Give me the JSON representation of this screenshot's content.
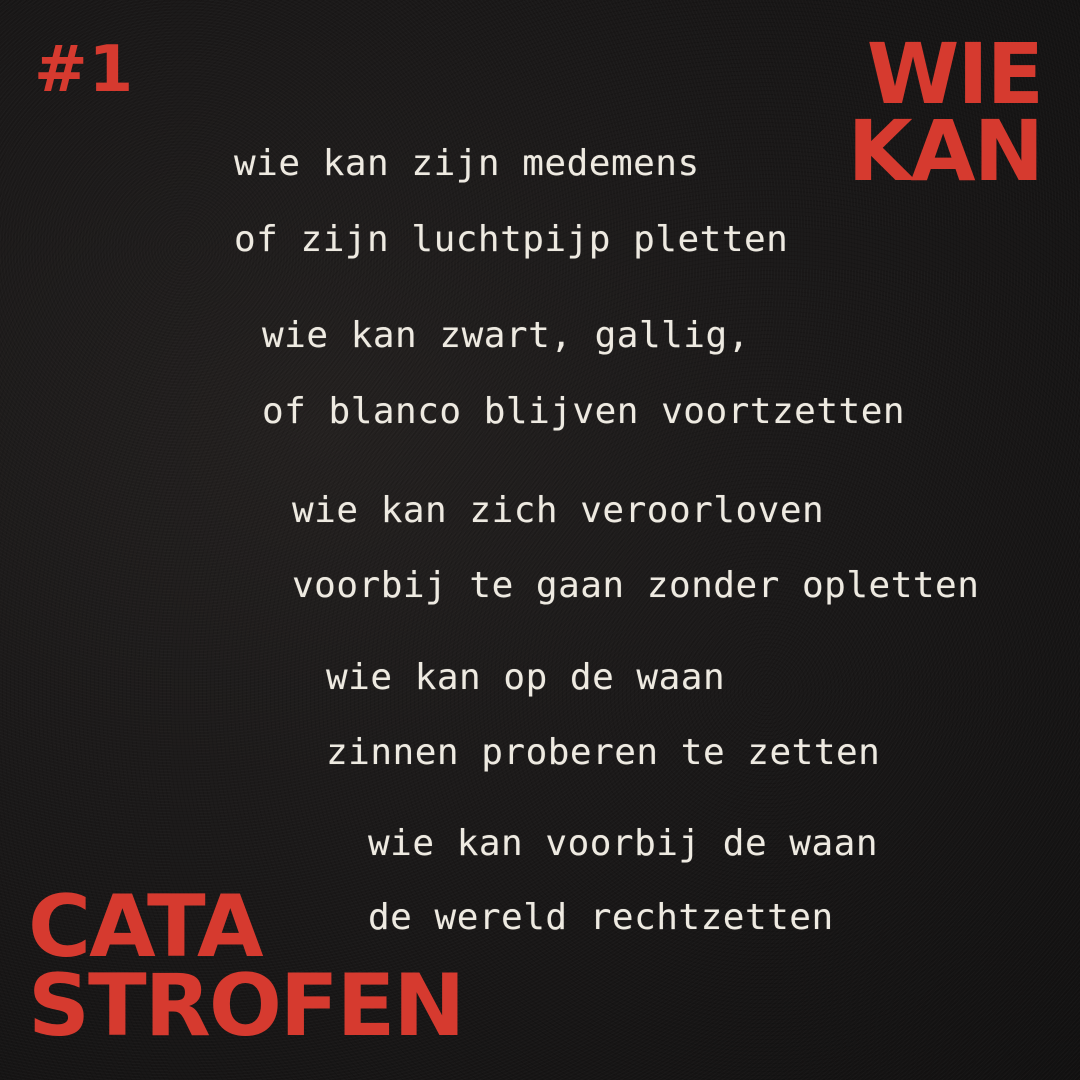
{
  "header": {
    "number": "#1",
    "title_lines": [
      "WIE",
      "KAN"
    ]
  },
  "footer": {
    "title_lines": [
      "CATA",
      "STROFEN"
    ]
  },
  "poem": {
    "stanzas": [
      {
        "lines": [
          "wie kan zijn medemens",
          "of zijn luchtpijp pletten"
        ]
      },
      {
        "lines": [
          "wie kan zwart, gallig,",
          "of blanco blijven voortzetten"
        ]
      },
      {
        "lines": [
          "wie kan zich veroorloven",
          "voorbij te gaan zonder opletten"
        ]
      },
      {
        "lines": [
          "wie kan op de waan",
          "zinnen proberen te zetten"
        ]
      },
      {
        "lines": [
          "wie kan voorbij de waan",
          "de wereld rechtzetten"
        ]
      }
    ]
  },
  "colors": {
    "background": "#1a1818",
    "accent": "#d63a2f",
    "text": "#eeeae1"
  }
}
